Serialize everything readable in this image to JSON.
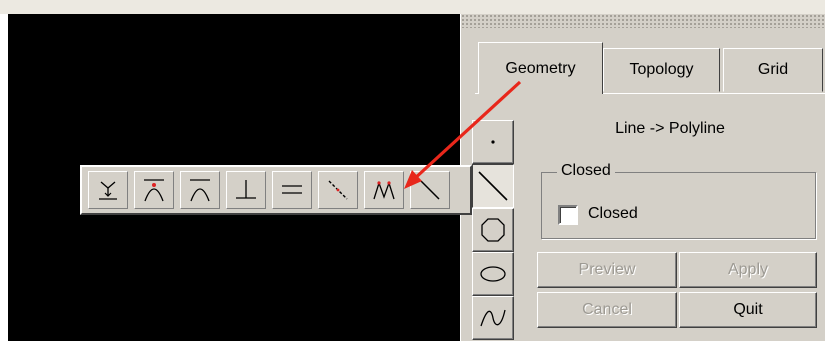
{
  "tabs": [
    {
      "label": "Geometry",
      "active": true
    },
    {
      "label": "Topology",
      "active": false
    },
    {
      "label": "Grid",
      "active": false
    }
  ],
  "mode_label": "Line -> Polyline",
  "closed_group": {
    "legend": "Closed",
    "checkbox_label": "Closed",
    "checked": false
  },
  "buttons": {
    "preview": {
      "label": "Preview",
      "enabled": false
    },
    "apply": {
      "label": "Apply",
      "enabled": false
    },
    "cancel": {
      "label": "Cancel",
      "enabled": false
    },
    "quit": {
      "label": "Quit",
      "enabled": true
    }
  },
  "tool_palette": [
    {
      "icon": "point-icon",
      "selected": false
    },
    {
      "icon": "line-icon",
      "selected": true
    },
    {
      "icon": "octagon-icon",
      "selected": false
    },
    {
      "icon": "ellipse-icon",
      "selected": false
    },
    {
      "icon": "wave-curve-icon",
      "selected": false
    }
  ],
  "floating_toolbar": [
    {
      "icon": "snap-down-icon"
    },
    {
      "icon": "arc-midpoint-icon"
    },
    {
      "icon": "arc-icon"
    },
    {
      "icon": "perpendicular-icon"
    },
    {
      "icon": "parallel-icon"
    },
    {
      "icon": "dashed-diagonal-icon"
    },
    {
      "icon": "polyline-points-icon"
    },
    {
      "icon": "diagonal-line-icon"
    }
  ],
  "colors": {
    "panel_bg": "#d4d0c8",
    "canvas_bg": "#000000",
    "annotation_arrow": "#e8271b",
    "disabled_text": "#9d9a93"
  }
}
